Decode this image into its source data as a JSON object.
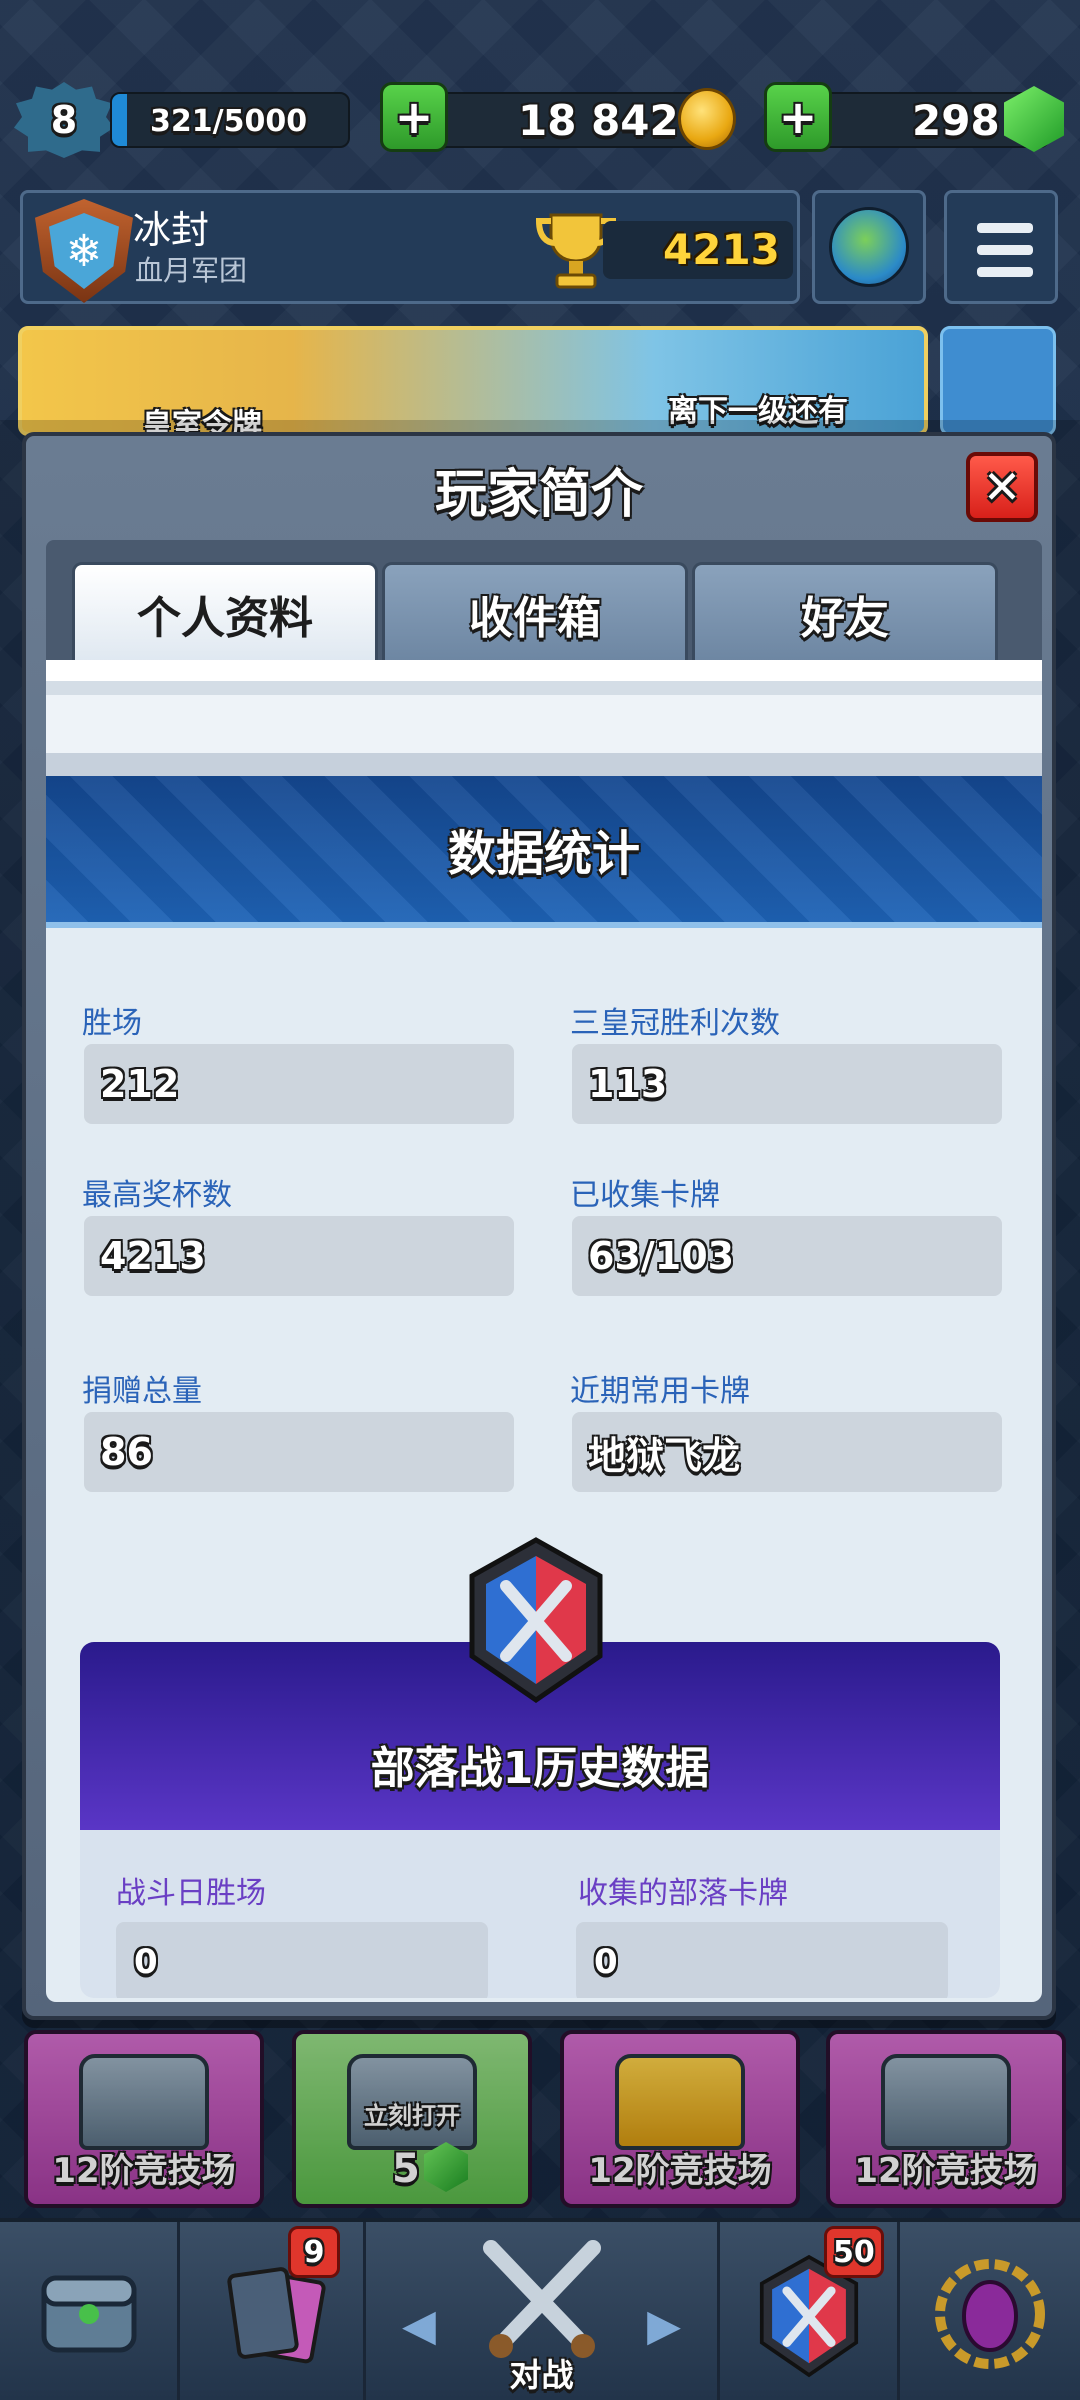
{
  "top_bar": {
    "level": "8",
    "xp": "321/5000",
    "xp_progress": 0.064,
    "gold": "18 842",
    "gems": "298"
  },
  "profile": {
    "player_name": "冰封",
    "clan_name": "血月军团",
    "trophies": "4213"
  },
  "banner": {
    "pass_label": "皇室令牌",
    "next_level_text": "离下一级还有"
  },
  "modal": {
    "title": "玩家简介",
    "tabs": [
      {
        "label": "个人资料",
        "active": true
      },
      {
        "label": "收件箱",
        "active": false
      },
      {
        "label": "好友",
        "active": false
      }
    ],
    "stats_title": "数据统计",
    "stats": [
      {
        "label": "胜场",
        "value": "212"
      },
      {
        "label": "三皇冠胜利次数",
        "value": "113"
      },
      {
        "label": "最高奖杯数",
        "value": "4213"
      },
      {
        "label": "已收集卡牌",
        "value": "63/103"
      },
      {
        "label": "捐赠总量",
        "value": "86"
      },
      {
        "label": "近期常用卡牌",
        "value": "地狱飞龙"
      }
    ],
    "clan_war": {
      "title": "部落战1历史数据",
      "stats": [
        {
          "label": "战斗日胜场",
          "value": "0"
        },
        {
          "label": "收集的部落卡牌",
          "value": "0"
        }
      ]
    }
  },
  "chests": [
    {
      "label": "12阶竞技场",
      "type": "silver"
    },
    {
      "label": "立刻打开",
      "cost": "5",
      "type": "silver-open"
    },
    {
      "label": "12阶竞技场",
      "type": "gold"
    },
    {
      "label": "12阶竞技场",
      "type": "silver"
    }
  ],
  "bottom_nav": {
    "cards_badge": "9",
    "battle_label": "对战",
    "clan_badge": "50"
  },
  "colors": {
    "accent_blue": "#1e63b6",
    "clan_war_purple": "#5a36c6",
    "gem_green": "#1f9a27",
    "close_red": "#d8201a"
  }
}
